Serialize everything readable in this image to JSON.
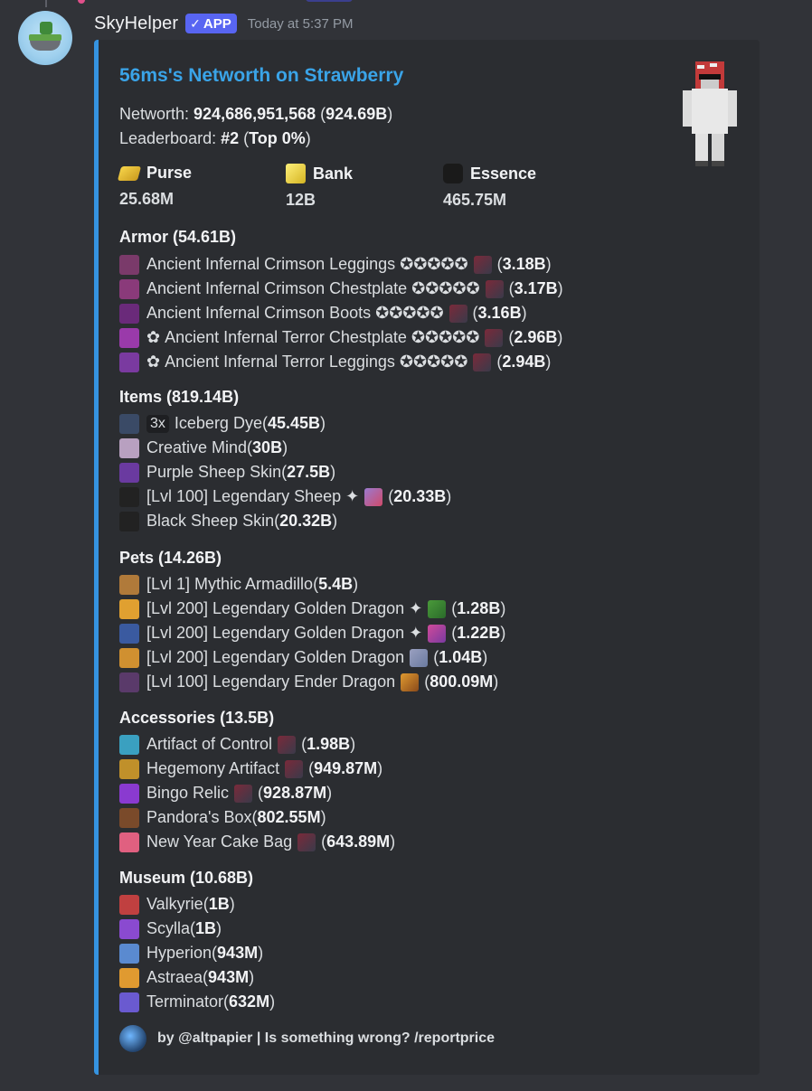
{
  "message": {
    "username": "SkyHelper",
    "badge": "APP",
    "badge_check": "✓",
    "timestamp": "Today at 5:37 PM"
  },
  "embed": {
    "accent_color": "#3593e0",
    "title": "56ms's Networth on Strawberry",
    "networth_label": "Networth: ",
    "networth_value": "924,686,951,568",
    "networth_short": "924.69B",
    "leaderboard_label": "Leaderboard: ",
    "leaderboard_rank": "#2",
    "leaderboard_top": "Top 0%",
    "stats": [
      {
        "icon": "gold-ingot-icon",
        "label": "Purse",
        "value": "25.68M"
      },
      {
        "icon": "gold-block-icon",
        "label": "Bank",
        "value": "12B"
      },
      {
        "icon": "essence-icon",
        "label": "Essence",
        "value": "465.75M"
      }
    ],
    "sections": [
      {
        "title": "Armor (54.61B)",
        "items": [
          {
            "icon": "crimson-leggings-icon",
            "color": "#7a3a6a",
            "pre": "",
            "name": "Ancient Infernal Crimson Leggings ✪✪✪✪✪",
            "extra": "gem-icon",
            "value": "3.18B"
          },
          {
            "icon": "crimson-chestplate-icon",
            "color": "#8a3a7a",
            "pre": "",
            "name": "Ancient Infernal Crimson Chestplate ✪✪✪✪✪",
            "extra": "gem-icon",
            "value": "3.17B"
          },
          {
            "icon": "crimson-boots-icon",
            "color": "#6a2a7a",
            "pre": "",
            "name": "Ancient Infernal Crimson Boots ✪✪✪✪✪",
            "extra": "gem-icon",
            "value": "3.16B"
          },
          {
            "icon": "terror-chestplate-icon",
            "color": "#9a3aaa",
            "pre": "✿ ",
            "name": "Ancient Infernal Terror Chestplate ✪✪✪✪✪",
            "extra": "gem-icon",
            "value": "2.96B"
          },
          {
            "icon": "terror-leggings-icon",
            "color": "#7a3aa0",
            "pre": "✿ ",
            "name": "Ancient Infernal Terror Leggings ✪✪✪✪✪",
            "extra": "gem-icon",
            "value": "2.94B"
          }
        ]
      },
      {
        "title": "Items (819.14B)",
        "items": [
          {
            "icon": "iceberg-dye-icon",
            "color": "#3a4a66",
            "pre": "",
            "qty": "3x",
            "name": "Iceberg Dye",
            "extra": "",
            "value": "45.45B"
          },
          {
            "icon": "creative-mind-icon",
            "color": "#b8a0c0",
            "pre": "",
            "name": "Creative Mind",
            "extra": "",
            "value": "30B"
          },
          {
            "icon": "purple-sheep-skin-icon",
            "color": "#6a3aa0",
            "pre": "",
            "name": "Purple Sheep Skin",
            "extra": "",
            "value": "27.5B"
          },
          {
            "icon": "sheep-pet-icon",
            "color": "#222",
            "pre": "",
            "name": "[Lvl 100] Legendary Sheep ✦",
            "extra": "book-icon",
            "value": "20.33B"
          },
          {
            "icon": "black-sheep-skin-icon",
            "color": "#222",
            "pre": "",
            "name": "Black Sheep Skin",
            "extra": "",
            "value": "20.32B"
          }
        ]
      },
      {
        "title": "Pets (14.26B)",
        "items": [
          {
            "icon": "armadillo-icon",
            "color": "#b07a3a",
            "pre": "",
            "name": "[Lvl 1] Mythic Armadillo",
            "extra": "",
            "value": "5.4B"
          },
          {
            "icon": "golden-dragon-icon",
            "color": "#e0a030",
            "pre": "",
            "name": "[Lvl 200] Legendary Golden Dragon ✦",
            "extra": "pet-item-green-icon",
            "value": "1.28B"
          },
          {
            "icon": "golden-dragon-blue-icon",
            "color": "#3a5aa0",
            "pre": "",
            "name": "[Lvl 200] Legendary Golden Dragon ✦",
            "extra": "potion-icon",
            "value": "1.22B"
          },
          {
            "icon": "golden-dragon-icon",
            "color": "#d09030",
            "pre": "",
            "name": "[Lvl 200] Legendary Golden Dragon",
            "extra": "pet-item-grey-icon",
            "value": "1.04B"
          },
          {
            "icon": "ender-dragon-icon",
            "color": "#5a3a6a",
            "pre": "",
            "name": "[Lvl 100] Legendary Ender Dragon",
            "extra": "tiger-icon",
            "value": "800.09M"
          }
        ]
      },
      {
        "title": "Accessories (13.5B)",
        "items": [
          {
            "icon": "artifact-of-control-icon",
            "color": "#3aa0c0",
            "pre": "",
            "name": "Artifact of Control",
            "extra": "gem-icon",
            "value": "1.98B"
          },
          {
            "icon": "hegemony-artifact-icon",
            "color": "#c0902a",
            "pre": "",
            "name": "Hegemony Artifact",
            "extra": "gem-icon",
            "value": "949.87M"
          },
          {
            "icon": "bingo-relic-icon",
            "color": "#8a3ad0",
            "pre": "",
            "name": "Bingo Relic",
            "extra": "gem-icon",
            "value": "928.87M"
          },
          {
            "icon": "pandoras-box-icon",
            "color": "#7a4a2a",
            "pre": "",
            "name": "Pandora's Box",
            "extra": "",
            "value": "802.55M"
          },
          {
            "icon": "cake-bag-icon",
            "color": "#e06080",
            "pre": "",
            "name": "New Year Cake Bag",
            "extra": "gem-icon",
            "value": "643.89M"
          }
        ]
      },
      {
        "title": "Museum (10.68B)",
        "items": [
          {
            "icon": "valkyrie-icon",
            "color": "#c04040",
            "pre": "",
            "name": "Valkyrie",
            "extra": "",
            "value": "1B"
          },
          {
            "icon": "scylla-icon",
            "color": "#8a4ad0",
            "pre": "",
            "name": "Scylla",
            "extra": "",
            "value": "1B"
          },
          {
            "icon": "hyperion-icon",
            "color": "#5a8ad0",
            "pre": "",
            "name": "Hyperion",
            "extra": "",
            "value": "943M"
          },
          {
            "icon": "astraea-icon",
            "color": "#e09a30",
            "pre": "",
            "name": "Astraea",
            "extra": "",
            "value": "943M"
          },
          {
            "icon": "terminator-icon",
            "color": "#6a5ad0",
            "pre": "",
            "name": "Terminator",
            "extra": "",
            "value": "632M"
          }
        ]
      }
    ],
    "footer": "by @altpapier | Is something wrong? /reportprice"
  }
}
